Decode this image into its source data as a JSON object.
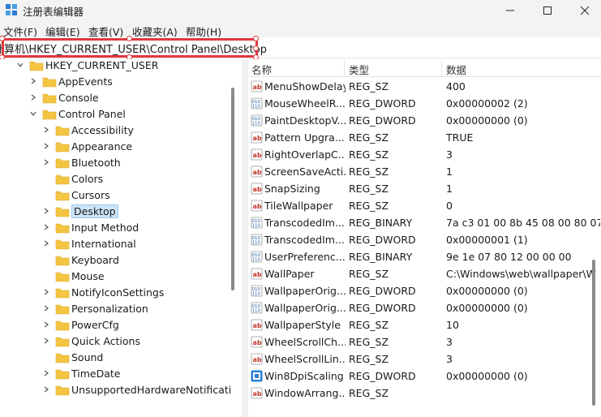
{
  "window": {
    "title": "注册表编辑器"
  },
  "menu": [
    "文件(F)",
    "编辑(E)",
    "查看(V)",
    "收藏夹(A)",
    "帮助(H)"
  ],
  "address": {
    "path": "计算机\\HKEY_CURRENT_USER\\Control Panel\\Desktop"
  },
  "tree": {
    "root": "HKEY_CURRENT_USER",
    "children": [
      "AppEvents",
      "Console",
      "Control Panel"
    ],
    "control_panel_children": [
      "Accessibility",
      "Appearance",
      "Bluetooth",
      "Colors",
      "Cursors",
      "Desktop",
      "Input Method",
      "International",
      "Keyboard",
      "Mouse",
      "NotifyIconSettings",
      "Personalization",
      "PowerCfg",
      "Quick Actions",
      "Sound",
      "TimeDate",
      "UnsupportedHardwareNotificati"
    ],
    "selected": "Desktop"
  },
  "columns": {
    "name": "名称",
    "type": "类型",
    "data": "数据"
  },
  "values": [
    {
      "name": "MenuShowDelay",
      "type": "REG_SZ",
      "data": "400",
      "icon": "string-icon"
    },
    {
      "name": "MouseWheelR...",
      "type": "REG_DWORD",
      "data": "0x00000002 (2)",
      "icon": "binary-icon"
    },
    {
      "name": "PaintDesktopV...",
      "type": "REG_DWORD",
      "data": "0x00000000 (0)",
      "icon": "binary-icon"
    },
    {
      "name": "Pattern Upgra...",
      "type": "REG_SZ",
      "data": "TRUE",
      "icon": "string-icon"
    },
    {
      "name": "RightOverlapC...",
      "type": "REG_SZ",
      "data": "3",
      "icon": "string-icon"
    },
    {
      "name": "ScreenSaveActi...",
      "type": "REG_SZ",
      "data": "1",
      "icon": "string-icon"
    },
    {
      "name": "SnapSizing",
      "type": "REG_SZ",
      "data": "1",
      "icon": "string-icon"
    },
    {
      "name": "TileWallpaper",
      "type": "REG_SZ",
      "data": "0",
      "icon": "string-icon"
    },
    {
      "name": "TranscodedIm...",
      "type": "REG_BINARY",
      "data": "7a c3 01 00 8b 45 08 00 80 07",
      "icon": "binary-icon"
    },
    {
      "name": "TranscodedIm...",
      "type": "REG_DWORD",
      "data": "0x00000001 (1)",
      "icon": "binary-icon"
    },
    {
      "name": "UserPreferenc...",
      "type": "REG_BINARY",
      "data": "9e 1e 07 80 12 00 00 00",
      "icon": "binary-icon"
    },
    {
      "name": "WallPaper",
      "type": "REG_SZ",
      "data": "C:\\Windows\\web\\wallpaper\\W",
      "icon": "string-icon"
    },
    {
      "name": "WallpaperOrig...",
      "type": "REG_DWORD",
      "data": "0x00000000 (0)",
      "icon": "binary-icon"
    },
    {
      "name": "WallpaperOrig...",
      "type": "REG_DWORD",
      "data": "0x00000000 (0)",
      "icon": "binary-icon"
    },
    {
      "name": "WallpaperStyle",
      "type": "REG_SZ",
      "data": "10",
      "icon": "string-icon"
    },
    {
      "name": "WheelScrollCh...",
      "type": "REG_SZ",
      "data": "3",
      "icon": "string-icon"
    },
    {
      "name": "WheelScrollLin...",
      "type": "REG_SZ",
      "data": "3",
      "icon": "string-icon"
    },
    {
      "name": "Win8DpiScaling",
      "type": "REG_DWORD",
      "data": "0x00000000 (0)",
      "icon": "dpi-icon"
    },
    {
      "name": "WindowArrang...",
      "type": "REG_SZ",
      "data": "",
      "icon": "string-icon"
    }
  ],
  "colors": {
    "accent": "#e0393e",
    "folder": "#f4c542",
    "selection": "#cce4f7"
  }
}
